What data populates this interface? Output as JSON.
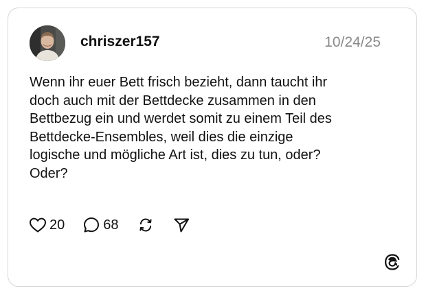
{
  "post": {
    "username": "chriszer157",
    "date": "10/24/25",
    "text": "Wenn ihr euer Bett frisch bezieht, dann taucht ihr\ndoch auch mit der Bettdecke zusammen in den\nBettbezug ein und werdet somit zu einem Teil des\nBettdecke-Ensembles, weil dies die einzige\nlogische und mögliche Art ist, dies zu tun, oder?\nOder?"
  },
  "actions": {
    "like_count": "20",
    "reply_count": "68"
  },
  "icons": {
    "like": "heart-icon",
    "reply": "speech-bubble-icon",
    "repost": "repost-icon",
    "share": "send-icon",
    "brand": "threads-logo-icon"
  },
  "colors": {
    "text": "#111111",
    "date": "#8a8a8a",
    "border": "#d6d6d6"
  }
}
